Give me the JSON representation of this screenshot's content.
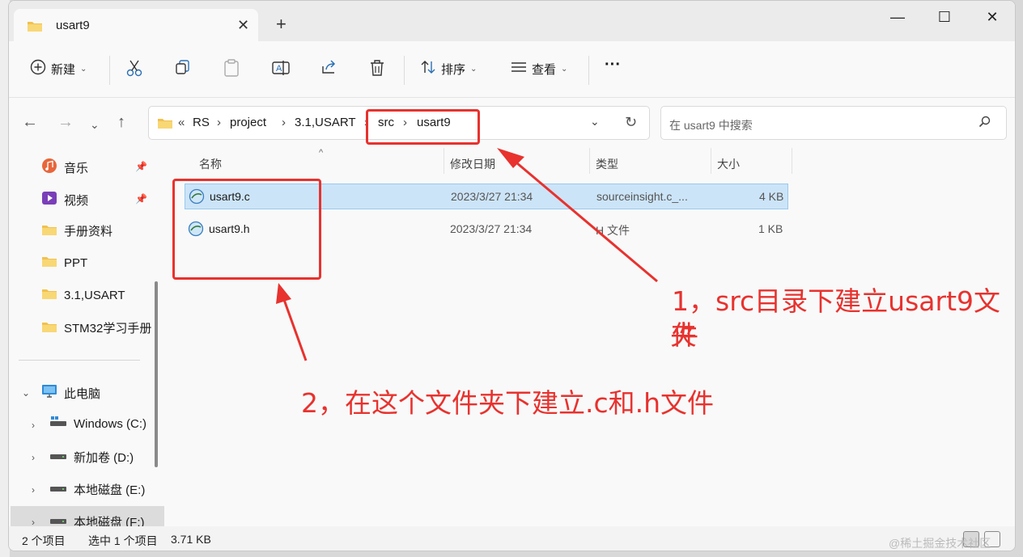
{
  "window": {
    "tab_title": "usart9",
    "new_tab": "+",
    "close_tab": "✕",
    "minimize": "—",
    "maximize": "☐",
    "close": "✕"
  },
  "toolbar": {
    "new_label": "新建",
    "sort_label": "排序",
    "view_label": "查看",
    "more_label": "···"
  },
  "address": {
    "overflow": "«",
    "crumbs": [
      "RS",
      "project",
      "3.1,USART",
      "src",
      "usart9"
    ]
  },
  "search": {
    "placeholder": "在 usart9 中搜索"
  },
  "sidebar": {
    "items": [
      {
        "label": "音乐",
        "icon": "music-icon",
        "pinned": true
      },
      {
        "label": "视频",
        "icon": "video-icon",
        "pinned": true
      },
      {
        "label": "手册资料",
        "icon": "folder-icon"
      },
      {
        "label": "PPT",
        "icon": "folder-icon"
      },
      {
        "label": "3.1,USART",
        "icon": "folder-icon"
      },
      {
        "label": "STM32学习手册",
        "icon": "folder-icon"
      }
    ],
    "this_pc": "此电脑",
    "drives": [
      "Windows (C:)",
      "新加卷 (D:)",
      "本地磁盘 (E:)",
      "本地磁盘 (F:)"
    ]
  },
  "columns": {
    "name": "名称",
    "modified": "修改日期",
    "type": "类型",
    "size": "大小"
  },
  "files": [
    {
      "name": "usart9.c",
      "modified": "2023/3/27 21:34",
      "type": "sourceinsight.c_...",
      "size": "4 KB",
      "selected": true
    },
    {
      "name": "usart9.h",
      "modified": "2023/3/27 21:34",
      "type": "H 文件",
      "size": "1 KB",
      "selected": false
    }
  ],
  "status": {
    "count": "2 个项目",
    "selected": "选中 1 个项目",
    "selected_size": "3.71 KB"
  },
  "annotations": {
    "note1_line1": "1，src目录下建立usart9文件",
    "note1_line2": "夹",
    "note2": "2，在这个文件夹下建立.c和.h文件",
    "color": "#e8322e"
  },
  "watermark": "@稀土掘金技术社区"
}
